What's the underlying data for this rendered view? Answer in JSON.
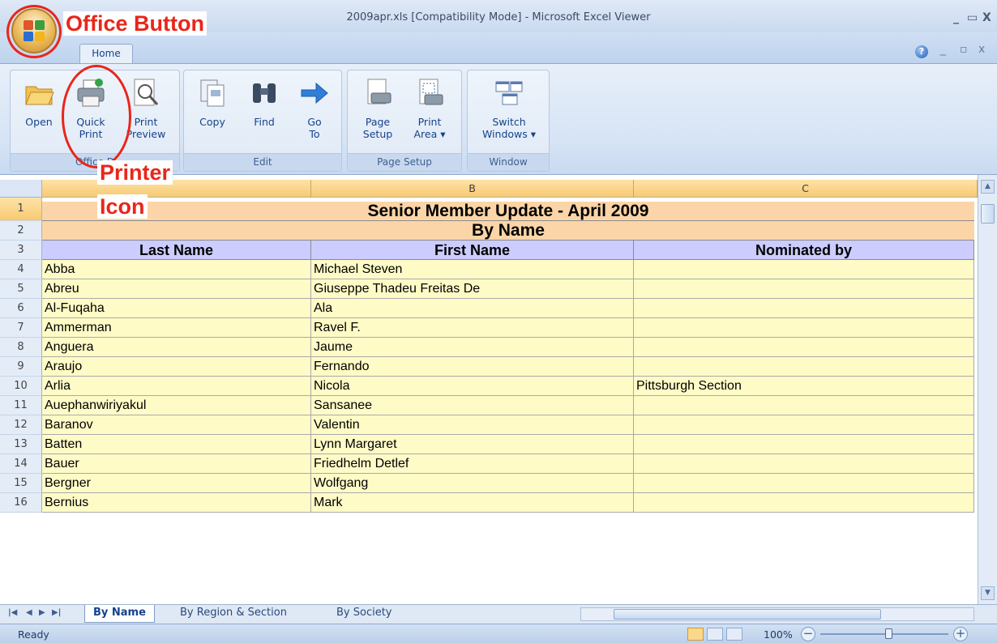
{
  "window": {
    "title": "2009apr.xls  [Compatibility Mode] - Microsoft Excel Viewer",
    "controls": {
      "minimize": "_",
      "restore": "▭",
      "close": "X"
    }
  },
  "ribbon": {
    "tab": "Home",
    "groups": [
      {
        "name": "Office D...",
        "buttons": [
          "Open",
          "Quick Print",
          "Print Preview"
        ]
      },
      {
        "name": "Edit",
        "buttons": [
          "Copy",
          "Find",
          "Go To"
        ]
      },
      {
        "name": "Page Setup",
        "buttons": [
          "Page Setup",
          "Print Area ▾"
        ]
      },
      {
        "name": "Window",
        "buttons": [
          "Switch Windows ▾"
        ]
      }
    ],
    "labels": {
      "open": "Open",
      "quick1": "Quick",
      "quick2": "Print",
      "preview1": "Print",
      "preview2": "Preview",
      "copy": "Copy",
      "find": "Find",
      "goto1": "Go",
      "goto2": "To",
      "page1": "Page",
      "page2": "Setup",
      "area1": "Print",
      "area2": "Area ▾",
      "switch1": "Switch",
      "switch2": "Windows ▾",
      "group_office": "Office D",
      "group_edit": "Edit",
      "group_page": "Page Setup",
      "group_window": "Window"
    }
  },
  "annotations": {
    "office_button": "Office Button",
    "printer_icon_line1": "Printer",
    "printer_icon_line2": "Icon"
  },
  "sheet": {
    "columns": [
      "B",
      "C"
    ],
    "title": "Senior Member Update - April 2009",
    "subtitle": "By Name",
    "headers": {
      "last": "Last Name",
      "first": "First Name",
      "nominated": "Nominated by"
    },
    "rows": [
      {
        "n": "4",
        "last": "Abba",
        "first": "Michael Steven",
        "nom": ""
      },
      {
        "n": "5",
        "last": "Abreu",
        "first": "Giuseppe Thadeu Freitas De",
        "nom": ""
      },
      {
        "n": "6",
        "last": "Al-Fuqaha",
        "first": "Ala",
        "nom": ""
      },
      {
        "n": "7",
        "last": "Ammerman",
        "first": "Ravel F.",
        "nom": ""
      },
      {
        "n": "8",
        "last": "Anguera",
        "first": "Jaume",
        "nom": ""
      },
      {
        "n": "9",
        "last": "Araujo",
        "first": "Fernando",
        "nom": ""
      },
      {
        "n": "10",
        "last": "Arlia",
        "first": "Nicola",
        "nom": "Pittsburgh Section"
      },
      {
        "n": "11",
        "last": "Auephanwiriyakul",
        "first": "Sansanee",
        "nom": ""
      },
      {
        "n": "12",
        "last": "Baranov",
        "first": "Valentin",
        "nom": ""
      },
      {
        "n": "13",
        "last": "Batten",
        "first": "Lynn Margaret",
        "nom": ""
      },
      {
        "n": "14",
        "last": "Bauer",
        "first": "Friedhelm Detlef",
        "nom": ""
      },
      {
        "n": "15",
        "last": "Bergner",
        "first": "Wolfgang",
        "nom": ""
      },
      {
        "n": "16",
        "last": "Bernius",
        "first": "Mark",
        "nom": ""
      }
    ],
    "rownums": {
      "r1": "1",
      "r2": "2",
      "r3": "3"
    }
  },
  "sheet_tabs": [
    "By Name",
    "By Region  & Section",
    "By Society"
  ],
  "status": {
    "text": "Ready",
    "zoom": "100%"
  },
  "colors": {
    "header_row": "#ccccff",
    "banner": "#fbd5a7",
    "data_cells": "#fffbc7",
    "annotation": "#e8261a"
  }
}
